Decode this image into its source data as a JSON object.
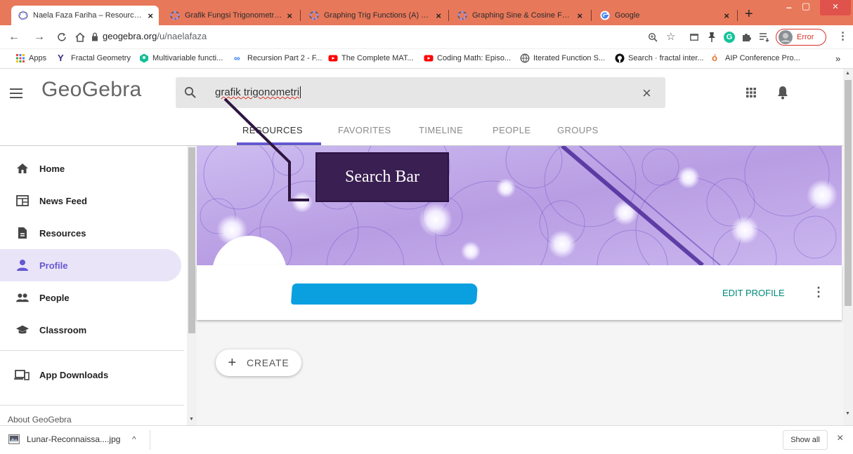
{
  "browser": {
    "tabs": [
      {
        "title": "Naela Faza Fariha – Resources –",
        "active": true
      },
      {
        "title": "Grafik Fungsi Trigonometri – Ge",
        "active": false
      },
      {
        "title": "Graphing Trig Functions (A) – G",
        "active": false
      },
      {
        "title": "Graphing Sine & Cosine Functio",
        "active": false
      },
      {
        "title": "Google",
        "active": false
      }
    ],
    "close_symbol": "×",
    "new_tab_symbol": "+",
    "window_controls": [
      "–",
      "▢",
      "×"
    ],
    "url_domain": "geogebra.org",
    "url_path": "/u/naelafaza",
    "profile_status": "Error",
    "bookmarks": [
      "Apps",
      "Fractal Geometry",
      "Multivariable functi...",
      "Recursion Part 2 - F...",
      "The Complete MAT...",
      "Coding Math: Episo...",
      "Iterated Function S...",
      "Search · fractal inter...",
      "AIP Conference Pro..."
    ],
    "bookmarks_overflow": "»"
  },
  "app": {
    "logo": "GeoGebra",
    "search": {
      "value": "grafik trigonometri",
      "clear_symbol": "×"
    },
    "tabs": [
      "RESOURCES",
      "FAVORITES",
      "TIMELINE",
      "PEOPLE",
      "GROUPS"
    ],
    "active_tab": "RESOURCES",
    "annotation_label": "Search Bar",
    "sidebar": {
      "items": [
        {
          "label": "Home",
          "icon": "home-icon"
        },
        {
          "label": "News Feed",
          "icon": "news-feed-icon"
        },
        {
          "label": "Resources",
          "icon": "resources-icon"
        },
        {
          "label": "Profile",
          "icon": "profile-icon",
          "selected": true
        },
        {
          "label": "People",
          "icon": "people-icon"
        },
        {
          "label": "Classroom",
          "icon": "classroom-icon"
        },
        {
          "label": "App Downloads",
          "icon": "app-downloads-icon"
        }
      ],
      "footer": "About GeoGebra"
    },
    "profile": {
      "edit_label": "EDIT PROFILE",
      "more_symbol": "⋮"
    },
    "create_symbol": "+",
    "create_label": "CREATE"
  },
  "downloads": {
    "file": "Lunar-Reconnaissa....jpg",
    "chevron": "^",
    "show_all": "Show all",
    "close_symbol": "×"
  },
  "colors": {
    "tab_strip": "#e8785a",
    "accent_purple": "#6557d2",
    "edit_profile_green": "#00897b",
    "redaction_blue": "#0aa0e0",
    "annotation_box": "#3a1f52"
  }
}
